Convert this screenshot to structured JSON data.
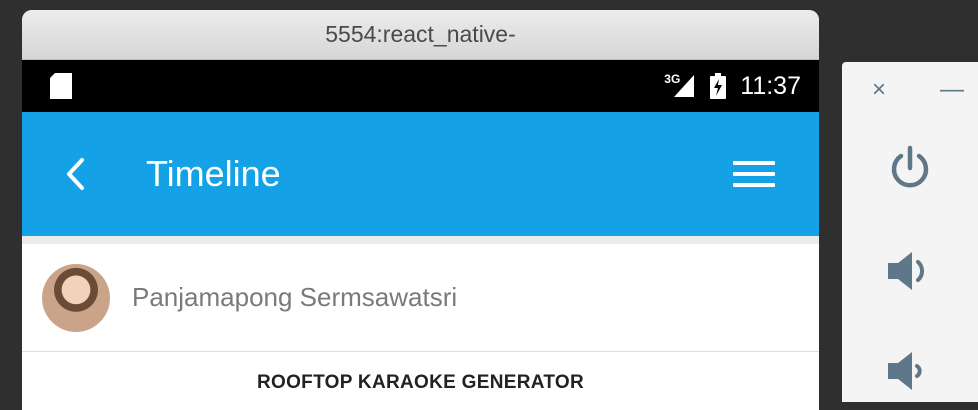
{
  "window": {
    "title": "5554:react_native-"
  },
  "status_bar": {
    "network": "3G",
    "time": "11:37"
  },
  "app_bar": {
    "title": "Timeline"
  },
  "post": {
    "author": "Panjamapong Sermsawatsri",
    "title": "ROOFTOP KARAOKE GENERATOR"
  },
  "side_panel": {
    "close_glyph": "×",
    "minimize_glyph": "—"
  },
  "colors": {
    "app_bar": "#15a1e6",
    "status_bar": "#000000",
    "panel_icon": "#5f7889"
  },
  "icons": [
    "sd-card-icon",
    "signal-icon",
    "battery-charging-icon",
    "back-arrow-icon",
    "hamburger-menu-icon",
    "power-icon",
    "volume-up-icon",
    "volume-down-icon"
  ]
}
